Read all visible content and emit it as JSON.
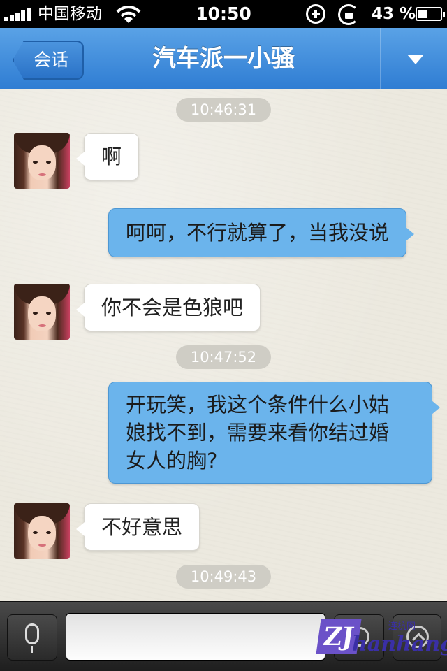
{
  "status_bar": {
    "carrier": "中国移动",
    "time": "10:50",
    "battery": "43 %",
    "battery_level": 0.43
  },
  "nav": {
    "back_label": "会话",
    "title": "汽车派一小骚"
  },
  "messages": {
    "ts1": "10:46:31",
    "m1": "啊",
    "m2": "呵呵，不行就算了，当我没说",
    "m3": "你不会是色狼吧",
    "ts2": "10:47:52",
    "m4": [
      "开玩笑，我这个条件什么小姑",
      "娘找不到，需要来看你结过婚",
      "女人的胸?"
    ],
    "m5": "不好意思",
    "ts3": "10:49:43"
  },
  "input": {
    "placeholder": ""
  },
  "watermark": {
    "mark": "ZJ",
    "brand": "hanhang",
    "small": "连杭网"
  },
  "icons": [
    "signal-icon",
    "wifi-icon",
    "plus-circle-icon",
    "rotation-lock-icon",
    "battery-icon",
    "dropdown-arrow-icon",
    "microphone-icon",
    "emoji-icon",
    "expand-icon"
  ]
}
